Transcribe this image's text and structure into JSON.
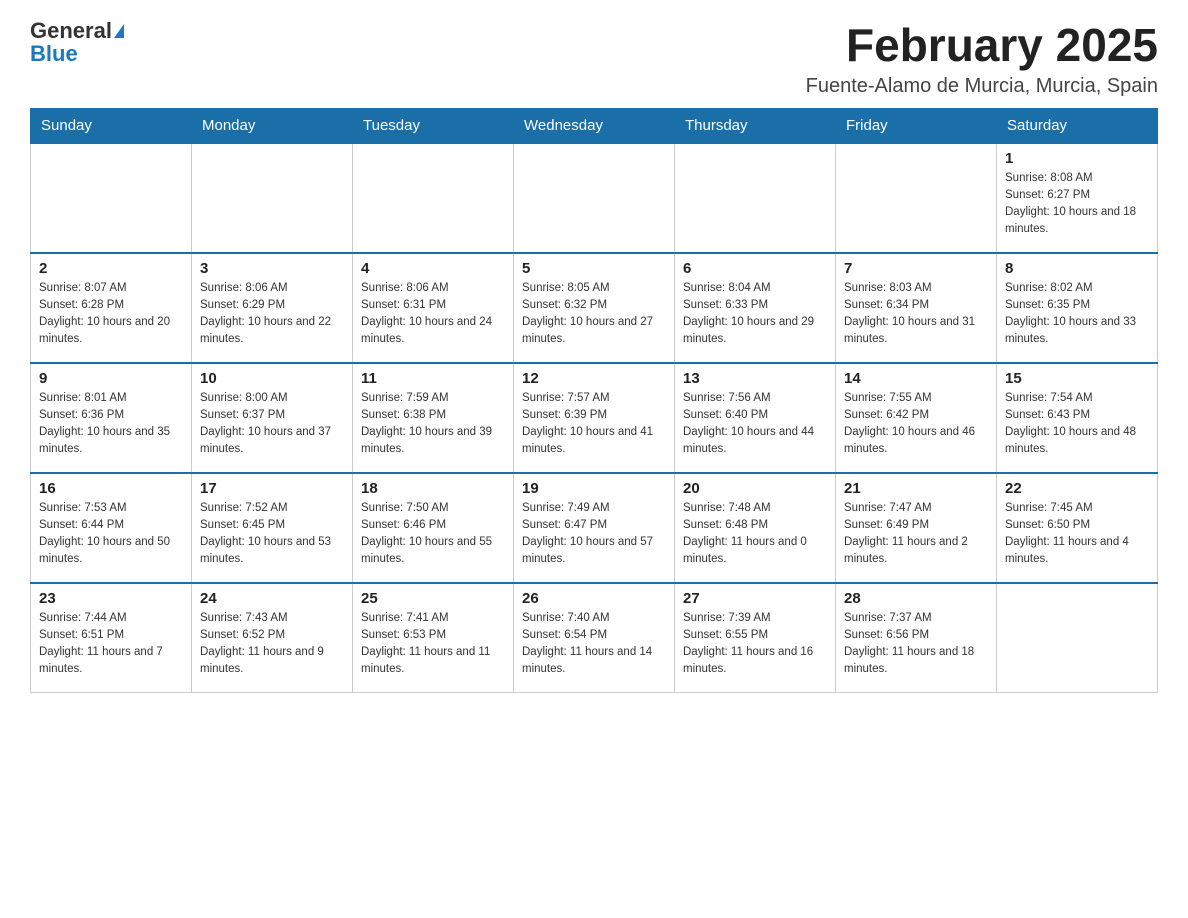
{
  "header": {
    "logo_general": "General",
    "logo_blue": "Blue",
    "month_title": "February 2025",
    "location": "Fuente-Alamo de Murcia, Murcia, Spain"
  },
  "weekdays": [
    "Sunday",
    "Monday",
    "Tuesday",
    "Wednesday",
    "Thursday",
    "Friday",
    "Saturday"
  ],
  "weeks": [
    [
      {
        "day": "",
        "info": ""
      },
      {
        "day": "",
        "info": ""
      },
      {
        "day": "",
        "info": ""
      },
      {
        "day": "",
        "info": ""
      },
      {
        "day": "",
        "info": ""
      },
      {
        "day": "",
        "info": ""
      },
      {
        "day": "1",
        "info": "Sunrise: 8:08 AM\nSunset: 6:27 PM\nDaylight: 10 hours and 18 minutes."
      }
    ],
    [
      {
        "day": "2",
        "info": "Sunrise: 8:07 AM\nSunset: 6:28 PM\nDaylight: 10 hours and 20 minutes."
      },
      {
        "day": "3",
        "info": "Sunrise: 8:06 AM\nSunset: 6:29 PM\nDaylight: 10 hours and 22 minutes."
      },
      {
        "day": "4",
        "info": "Sunrise: 8:06 AM\nSunset: 6:31 PM\nDaylight: 10 hours and 24 minutes."
      },
      {
        "day": "5",
        "info": "Sunrise: 8:05 AM\nSunset: 6:32 PM\nDaylight: 10 hours and 27 minutes."
      },
      {
        "day": "6",
        "info": "Sunrise: 8:04 AM\nSunset: 6:33 PM\nDaylight: 10 hours and 29 minutes."
      },
      {
        "day": "7",
        "info": "Sunrise: 8:03 AM\nSunset: 6:34 PM\nDaylight: 10 hours and 31 minutes."
      },
      {
        "day": "8",
        "info": "Sunrise: 8:02 AM\nSunset: 6:35 PM\nDaylight: 10 hours and 33 minutes."
      }
    ],
    [
      {
        "day": "9",
        "info": "Sunrise: 8:01 AM\nSunset: 6:36 PM\nDaylight: 10 hours and 35 minutes."
      },
      {
        "day": "10",
        "info": "Sunrise: 8:00 AM\nSunset: 6:37 PM\nDaylight: 10 hours and 37 minutes."
      },
      {
        "day": "11",
        "info": "Sunrise: 7:59 AM\nSunset: 6:38 PM\nDaylight: 10 hours and 39 minutes."
      },
      {
        "day": "12",
        "info": "Sunrise: 7:57 AM\nSunset: 6:39 PM\nDaylight: 10 hours and 41 minutes."
      },
      {
        "day": "13",
        "info": "Sunrise: 7:56 AM\nSunset: 6:40 PM\nDaylight: 10 hours and 44 minutes."
      },
      {
        "day": "14",
        "info": "Sunrise: 7:55 AM\nSunset: 6:42 PM\nDaylight: 10 hours and 46 minutes."
      },
      {
        "day": "15",
        "info": "Sunrise: 7:54 AM\nSunset: 6:43 PM\nDaylight: 10 hours and 48 minutes."
      }
    ],
    [
      {
        "day": "16",
        "info": "Sunrise: 7:53 AM\nSunset: 6:44 PM\nDaylight: 10 hours and 50 minutes."
      },
      {
        "day": "17",
        "info": "Sunrise: 7:52 AM\nSunset: 6:45 PM\nDaylight: 10 hours and 53 minutes."
      },
      {
        "day": "18",
        "info": "Sunrise: 7:50 AM\nSunset: 6:46 PM\nDaylight: 10 hours and 55 minutes."
      },
      {
        "day": "19",
        "info": "Sunrise: 7:49 AM\nSunset: 6:47 PM\nDaylight: 10 hours and 57 minutes."
      },
      {
        "day": "20",
        "info": "Sunrise: 7:48 AM\nSunset: 6:48 PM\nDaylight: 11 hours and 0 minutes."
      },
      {
        "day": "21",
        "info": "Sunrise: 7:47 AM\nSunset: 6:49 PM\nDaylight: 11 hours and 2 minutes."
      },
      {
        "day": "22",
        "info": "Sunrise: 7:45 AM\nSunset: 6:50 PM\nDaylight: 11 hours and 4 minutes."
      }
    ],
    [
      {
        "day": "23",
        "info": "Sunrise: 7:44 AM\nSunset: 6:51 PM\nDaylight: 11 hours and 7 minutes."
      },
      {
        "day": "24",
        "info": "Sunrise: 7:43 AM\nSunset: 6:52 PM\nDaylight: 11 hours and 9 minutes."
      },
      {
        "day": "25",
        "info": "Sunrise: 7:41 AM\nSunset: 6:53 PM\nDaylight: 11 hours and 11 minutes."
      },
      {
        "day": "26",
        "info": "Sunrise: 7:40 AM\nSunset: 6:54 PM\nDaylight: 11 hours and 14 minutes."
      },
      {
        "day": "27",
        "info": "Sunrise: 7:39 AM\nSunset: 6:55 PM\nDaylight: 11 hours and 16 minutes."
      },
      {
        "day": "28",
        "info": "Sunrise: 7:37 AM\nSunset: 6:56 PM\nDaylight: 11 hours and 18 minutes."
      },
      {
        "day": "",
        "info": ""
      }
    ]
  ]
}
